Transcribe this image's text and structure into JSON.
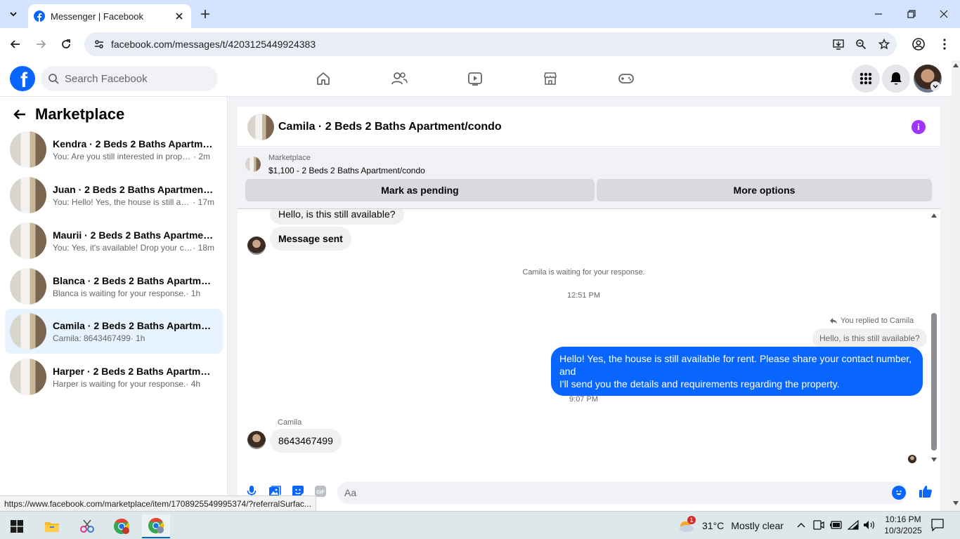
{
  "browser": {
    "tab_title": "Messenger | Facebook",
    "url": "facebook.com/messages/t/4203125449924383",
    "status_url": "https://www.facebook.com/marketplace/item/1708925549995374/?referralSurfac..."
  },
  "fb": {
    "search_placeholder": "Search Facebook"
  },
  "sidebar": {
    "title": "Marketplace",
    "conversations": [
      {
        "name": "Kendra · 2 Beds 2 Baths Apartmen...",
        "preview": "You: Are you still interested in proper...",
        "time": " · 2m",
        "active": false
      },
      {
        "name": "Juan · 2 Beds 2 Baths Apartment/c...",
        "preview": "You: Hello! Yes, the house is still avai...",
        "time": " · 17m",
        "active": false
      },
      {
        "name": "Maurii · 2 Beds 2 Baths Apartment...",
        "preview": "You: Yes, it's available! Drop your co...",
        "time": " · 18m",
        "active": false
      },
      {
        "name": "Blanca · 2 Beds 2 Baths Apartment...",
        "preview": "Blanca is waiting for your response.",
        "time": " · 1h",
        "active": false
      },
      {
        "name": "Camila · 2 Beds 2 Baths Apartment...",
        "preview": "Camila: 8643467499",
        "time": " · 1h",
        "active": true
      },
      {
        "name": "Harper · 2 Beds 2 Baths Apartment...",
        "preview": "Harper is waiting for your response.",
        "time": " · 4h",
        "active": false
      }
    ]
  },
  "chat": {
    "title": "Camila · 2 Beds 2 Baths Apartment/condo",
    "listing_source": "Marketplace",
    "listing_title": "$1,100 - 2 Beds 2 Baths Apartment/condo",
    "mark_pending_label": "Mark as pending",
    "more_options_label": "More options",
    "messages": {
      "first_in": "Hello, is this still available?",
      "second_in": "Message sent",
      "waiting_note": "Camila is waiting for your response.",
      "time1": "12:51 PM",
      "replied_to": "You replied to Camila",
      "quoted": "Hello, is this still available?",
      "out_line1": "Hello! Yes, the house is still available for rent. Please share your contact number, and",
      "out_line2": "I'll send you the details and requirements regarding the property.",
      "time2": "9:07 PM",
      "sender": "Camila",
      "last_in": "8643467499"
    },
    "composer_placeholder": "Aa"
  },
  "taskbar": {
    "temperature": "31°C",
    "condition": "Mostly clear",
    "weather_badge": "1",
    "time": "10:16 PM",
    "date": "10/3/2025"
  },
  "colors": {
    "fb_blue": "#0866ff",
    "active_conv": "#e7f3ff",
    "info_purple": "#a033ff"
  }
}
